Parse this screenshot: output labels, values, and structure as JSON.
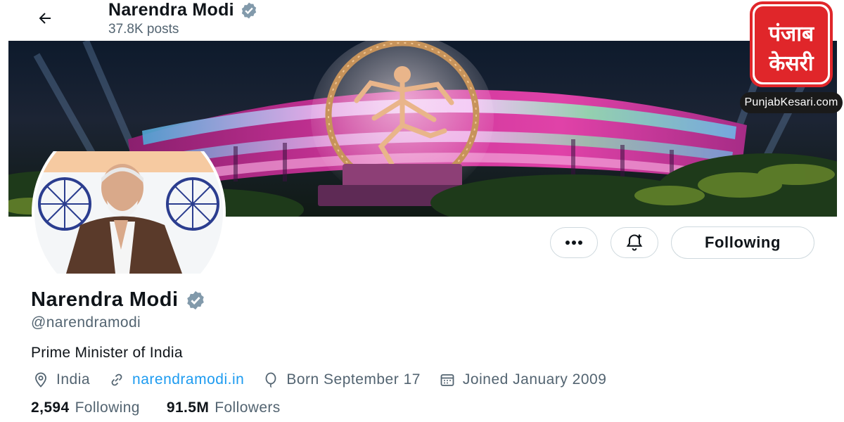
{
  "header": {
    "name": "Narendra Modi",
    "posts": "37.8K posts"
  },
  "actions": {
    "following_label": "Following"
  },
  "profile": {
    "name": "Narendra Modi",
    "handle": "@narendramodi",
    "bio": "Prime Minister of India",
    "location": "India",
    "website": "narendramodi.in",
    "birthday": "Born September 17",
    "joined": "Joined January 2009"
  },
  "stats": {
    "following_count": "2,594",
    "following_label": "Following",
    "followers_count": "91.5M",
    "followers_label": "Followers"
  },
  "watermark": {
    "logo_text": "पंजाब केसरी",
    "site": "PunjabKesari.com"
  },
  "icons": [
    "back-arrow-icon",
    "verified-badge-icon",
    "more-icon",
    "notification-bell-icon",
    "location-icon",
    "link-icon",
    "balloon-icon",
    "calendar-icon"
  ],
  "colors": {
    "accent": "#1d9bf0",
    "verified_gray": "#829aab",
    "text_primary": "#0f1419",
    "text_secondary": "#536471",
    "border": "#cfd9de",
    "logo_red": "#e0262a"
  }
}
